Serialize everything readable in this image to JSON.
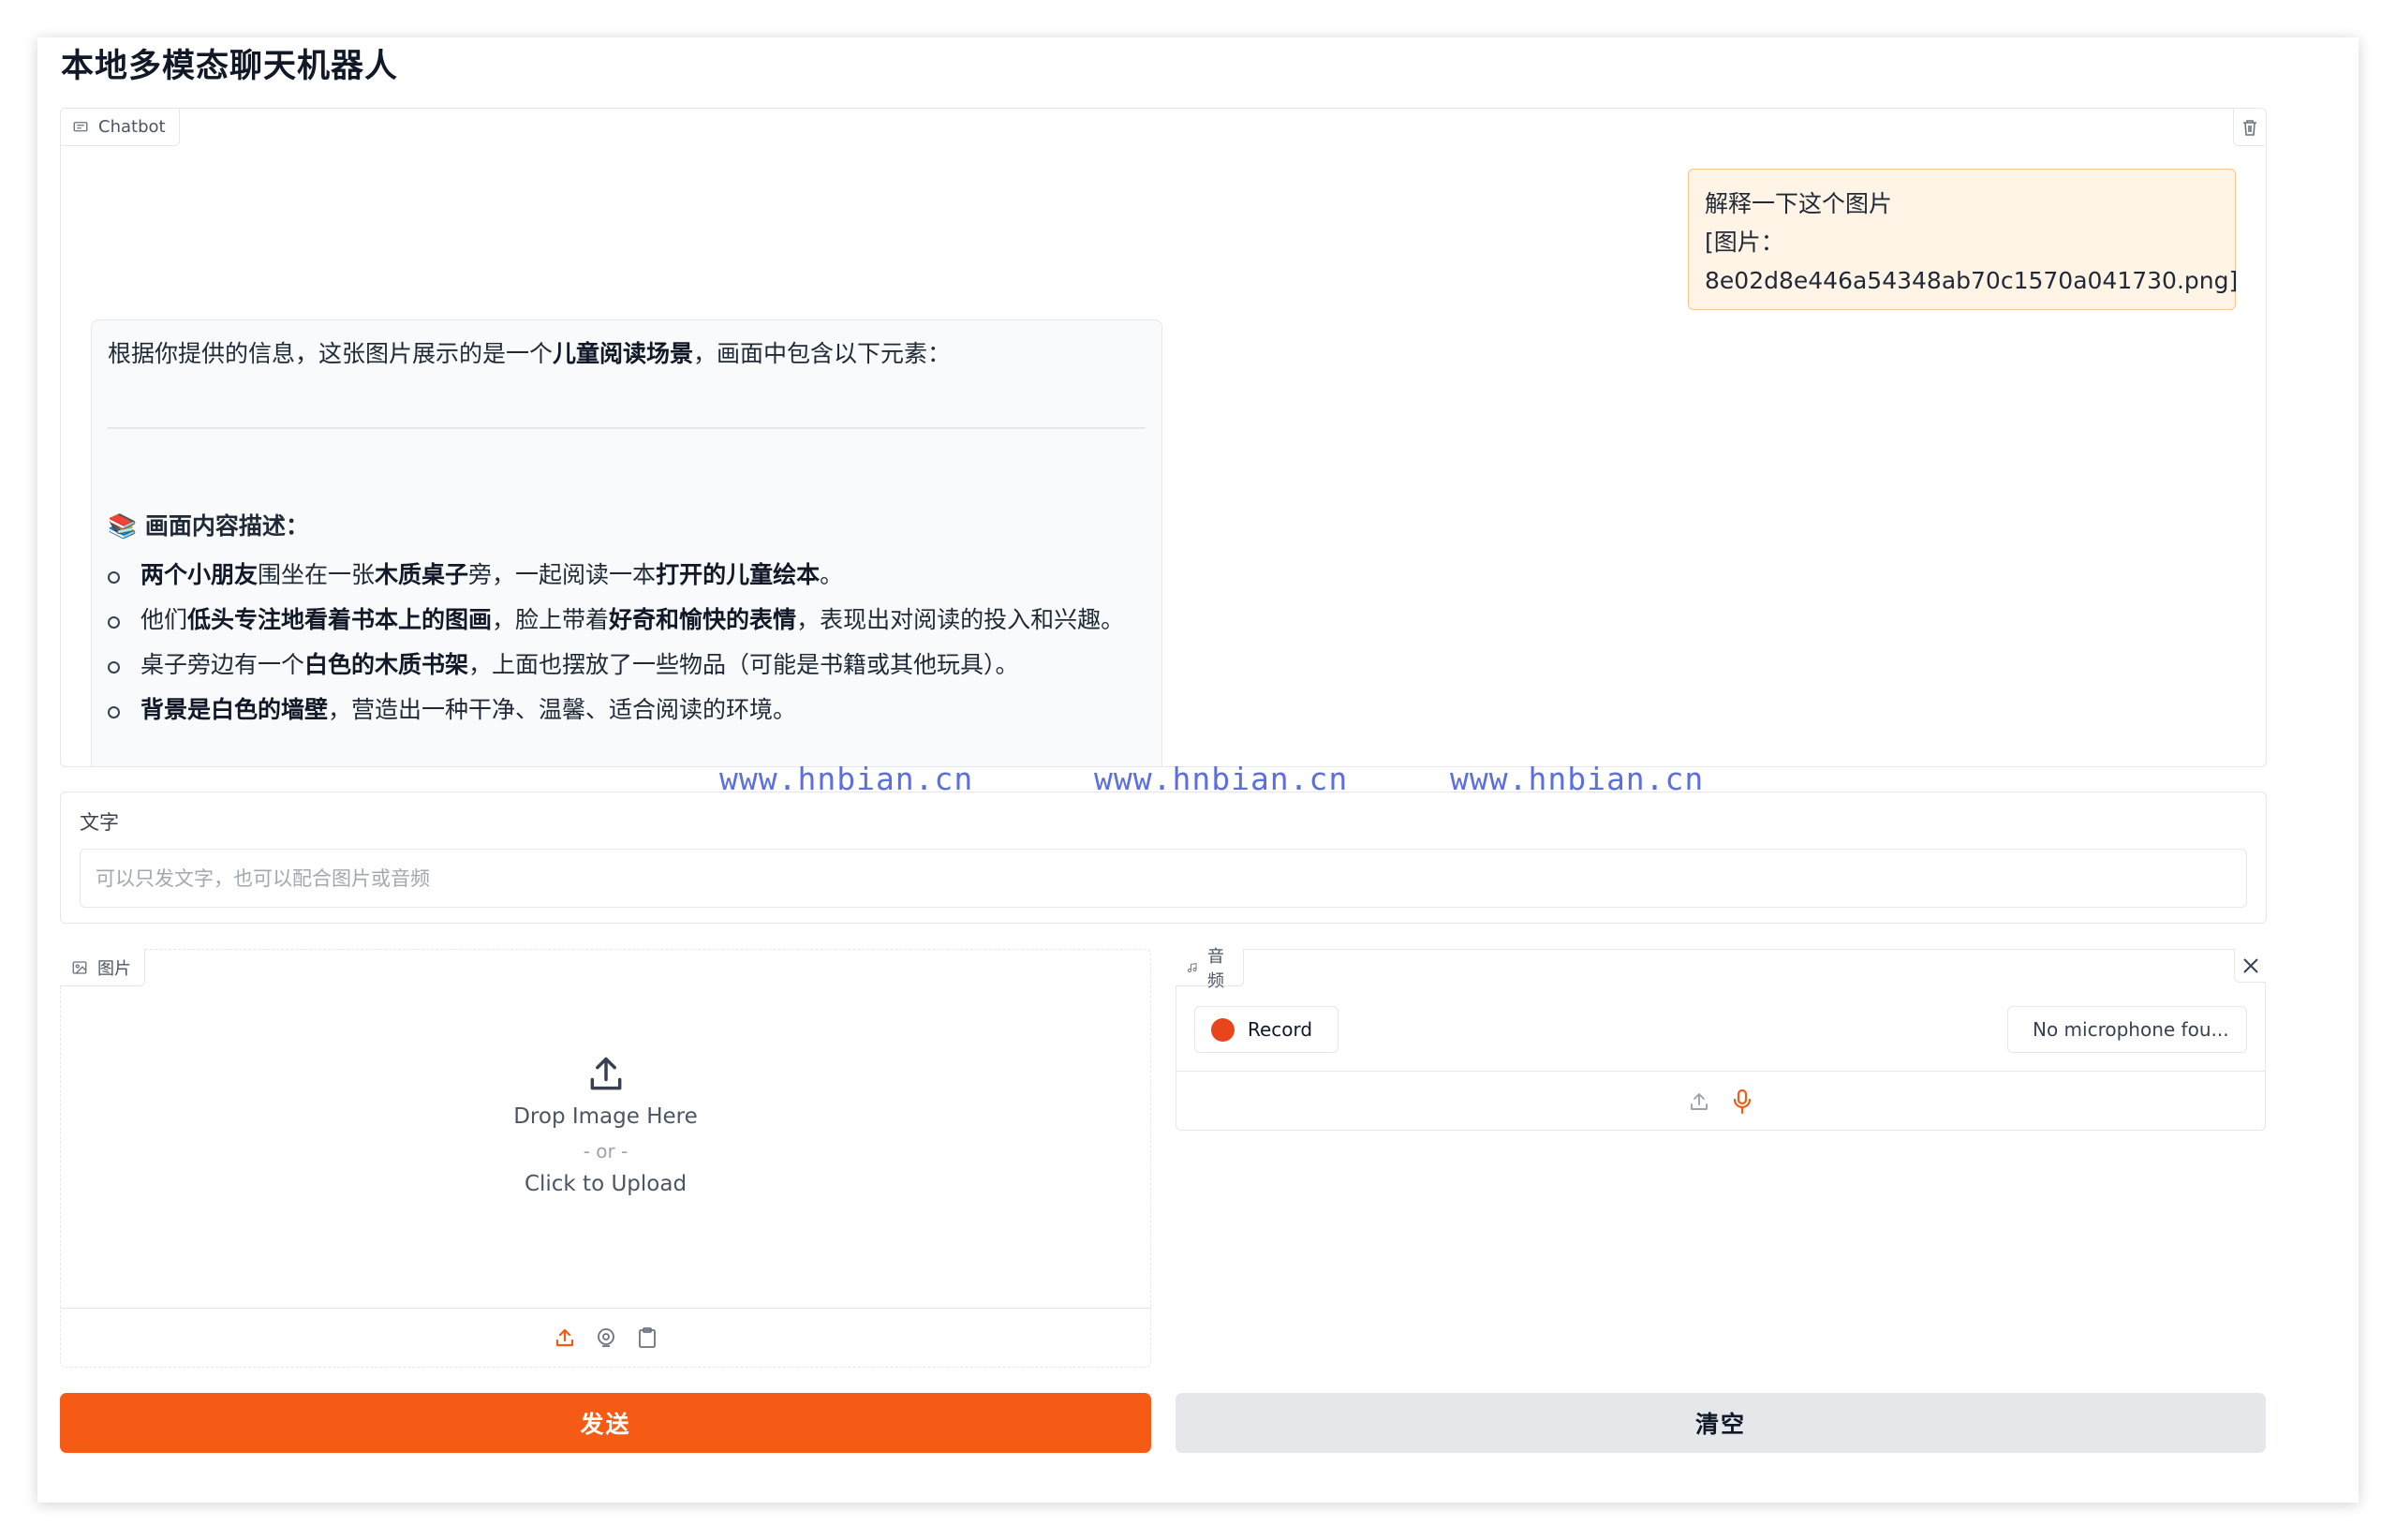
{
  "app": {
    "title": "本地多模态聊天机器人"
  },
  "chatbot": {
    "label": "Chatbot",
    "icon": "chat-icon",
    "clear_icon": "trash-icon",
    "user_message": {
      "line1": "解释一下这个图片",
      "line2": "[图片：8e02d8e446a54348ab70c1570a041730.png]"
    },
    "bot_message": {
      "intro_pre": "根据你提供的信息，这张图片展示的是一个",
      "intro_bold": "儿童阅读场景",
      "intro_post": "，画面中包含以下元素：",
      "section_emoji": "📚",
      "section_title": "画面内容描述：",
      "items": [
        {
          "parts": [
            {
              "t": "两个小朋友",
              "b": true
            },
            {
              "t": "围坐在一张",
              "b": false
            },
            {
              "t": "木质桌子",
              "b": true
            },
            {
              "t": "旁，一起阅读一本",
              "b": false
            },
            {
              "t": "打开的儿童绘本",
              "b": true
            },
            {
              "t": "。",
              "b": false
            }
          ]
        },
        {
          "parts": [
            {
              "t": "他们",
              "b": false
            },
            {
              "t": "低头专注地看着书本上的图画",
              "b": true
            },
            {
              "t": "，脸上带着",
              "b": false
            },
            {
              "t": "好奇和愉快的表情",
              "b": true
            },
            {
              "t": "，表现出对阅读的投入和兴趣。",
              "b": false
            }
          ]
        },
        {
          "parts": [
            {
              "t": "桌子旁边有一个",
              "b": false
            },
            {
              "t": "白色的木质书架",
              "b": true
            },
            {
              "t": "，上面也摆放了一些物品（可能是书籍或其他玩具）。",
              "b": false
            }
          ]
        },
        {
          "parts": [
            {
              "t": "背景是白色的墙壁",
              "b": true
            },
            {
              "t": "，营造出一种干净、温馨、适合阅读的环境。",
              "b": false
            }
          ]
        }
      ]
    },
    "scroll_icon": "arrow-down-icon"
  },
  "watermarks": [
    "www.hnbian.cn",
    "www.hnbian.cn",
    "www.hnbian.cn"
  ],
  "text_input": {
    "label": "文字",
    "value": "",
    "placeholder": "可以只发文字，也可以配合图片或音频"
  },
  "image_upload": {
    "label": "图片",
    "icon": "image-icon",
    "drop_text": "Drop Image Here",
    "or_text": "- or -",
    "click_text": "Click to Upload",
    "tools": [
      "upload-icon",
      "webcam-icon",
      "clipboard-icon"
    ]
  },
  "audio": {
    "label": "音频",
    "icon": "music-icon",
    "close_icon": "close-icon",
    "record_label": "Record",
    "mic_select": "No microphone fou...",
    "tools": [
      "upload-icon",
      "microphone-icon"
    ]
  },
  "buttons": {
    "send": "发送",
    "clear": "清空"
  },
  "colors": {
    "accent": "#f55b15",
    "user_bubble": "#fff4e6",
    "record_dot": "#e8451c",
    "watermark": "#5b6fe0"
  }
}
